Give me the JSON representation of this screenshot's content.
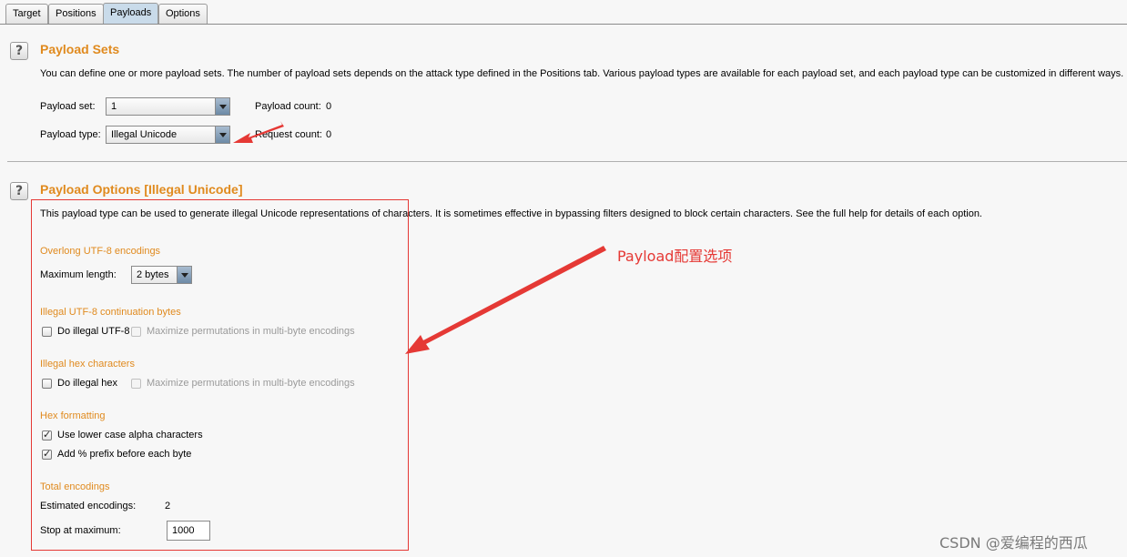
{
  "tabs": [
    {
      "label": "Target"
    },
    {
      "label": "Positions"
    },
    {
      "label": "Payloads"
    },
    {
      "label": "Options"
    }
  ],
  "payload_sets": {
    "title": "Payload Sets",
    "description": "You can define one or more payload sets. The number of payload sets depends on the attack type defined in the Positions tab. Various payload types are available for each payload set, and each payload type can be customized in different ways.",
    "set_label": "Payload set:",
    "set_value": "1",
    "type_label": "Payload type:",
    "type_value": "Illegal Unicode",
    "payload_count_label": "Payload count:",
    "payload_count": "0",
    "request_count_label": "Request count:",
    "request_count": "0"
  },
  "payload_options": {
    "title": "Payload Options [Illegal Unicode]",
    "description": "This payload type can be used to generate illegal Unicode representations of characters. It is sometimes effective in bypassing filters designed to block certain characters. See the full help for details of each option.",
    "overlong_heading": "Overlong UTF-8 encodings",
    "max_length_label": "Maximum length:",
    "max_length_value": "2 bytes",
    "continuation_heading": "Illegal UTF-8 continuation bytes",
    "do_illegal_utf8": "Do illegal UTF-8",
    "maximize_perm_1": "Maximize permutations in multi-byte encodings",
    "hex_heading": "Illegal hex characters",
    "do_illegal_hex": "Do illegal hex",
    "maximize_perm_2": "Maximize permutations in multi-byte encodings",
    "hex_format_heading": "Hex formatting",
    "lower_case": "Use lower case alpha characters",
    "add_prefix": "Add % prefix before each byte",
    "total_heading": "Total encodings",
    "estimated_label": "Estimated encodings:",
    "estimated_value": "2",
    "stop_label": "Stop at maximum:",
    "stop_value": "1000"
  },
  "annotation": "Payload配置选项",
  "watermark": "CSDN @爱编程的西瓜",
  "icons": {
    "help": "help-icon",
    "dropdown": "chevron-down-icon",
    "check": "check-icon"
  },
  "colors": {
    "accent": "#e08a1e",
    "annotation": "#e53935",
    "active_tab": "#c9dbea"
  }
}
